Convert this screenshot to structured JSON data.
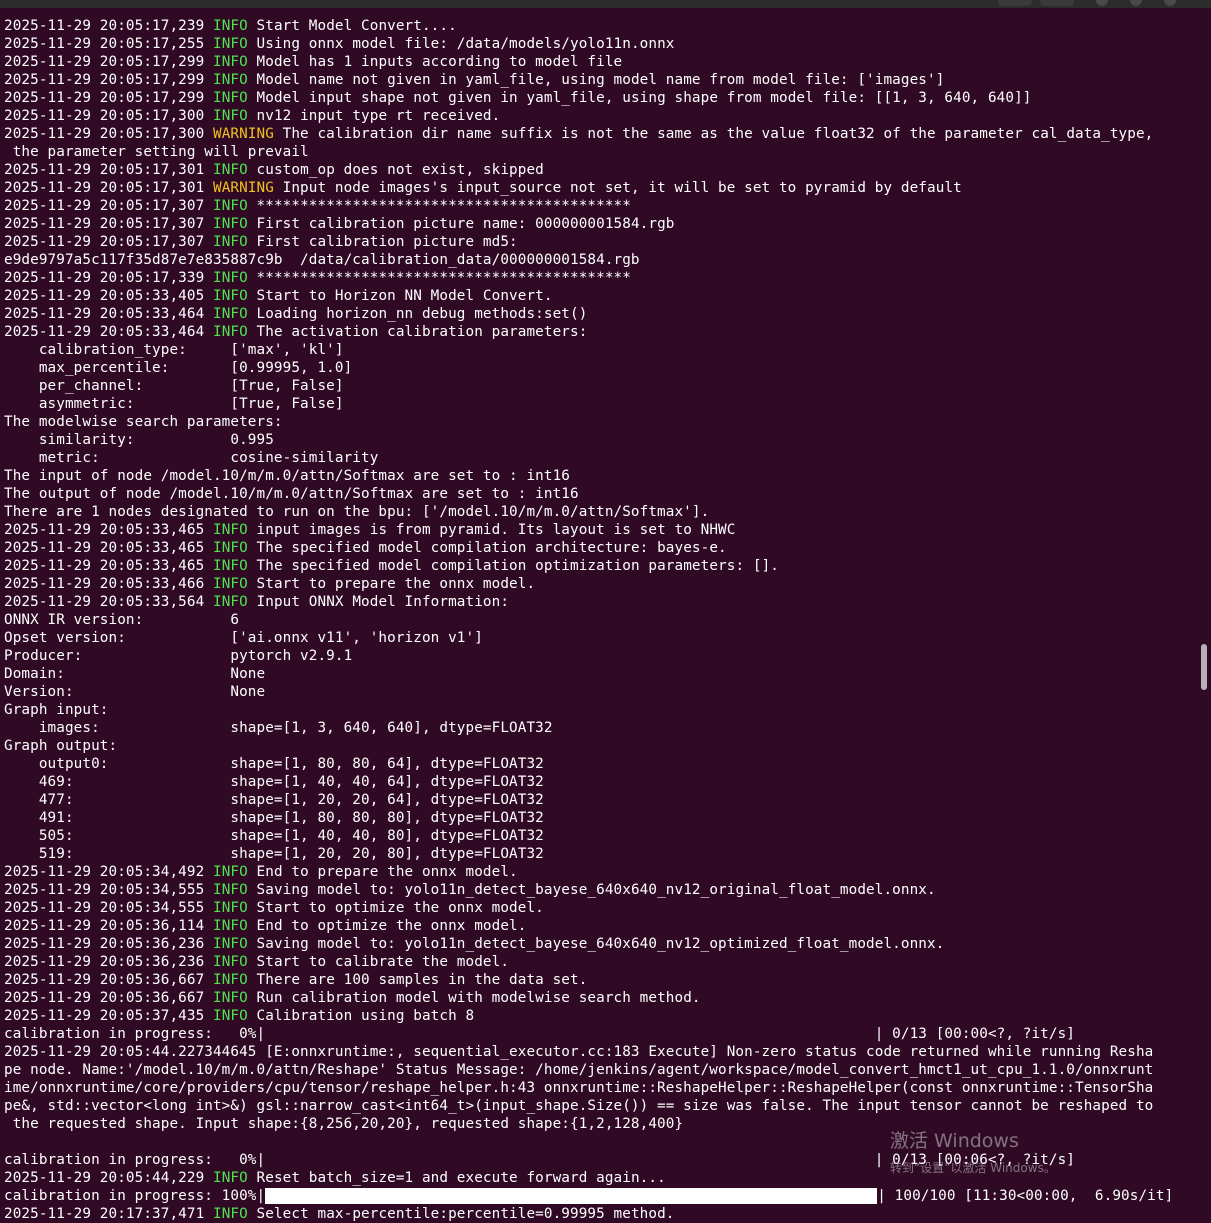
{
  "terminal": {
    "lines": [
      [
        {
          "t": "2025-11-29 20:05:17,239 "
        },
        {
          "t": "INFO",
          "c": "info"
        },
        {
          "t": " Start Model Convert...."
        }
      ],
      [
        {
          "t": "2025-11-29 20:05:17,255 "
        },
        {
          "t": "INFO",
          "c": "info"
        },
        {
          "t": " Using onnx model file: /data/models/yolo11n.onnx"
        }
      ],
      [
        {
          "t": "2025-11-29 20:05:17,299 "
        },
        {
          "t": "INFO",
          "c": "info"
        },
        {
          "t": " Model has 1 inputs according to model file"
        }
      ],
      [
        {
          "t": "2025-11-29 20:05:17,299 "
        },
        {
          "t": "INFO",
          "c": "info"
        },
        {
          "t": " Model name not given in yaml_file, using model name from model file: ['images']"
        }
      ],
      [
        {
          "t": "2025-11-29 20:05:17,299 "
        },
        {
          "t": "INFO",
          "c": "info"
        },
        {
          "t": " Model input shape not given in yaml_file, using shape from model file: [[1, 3, 640, 640]]"
        }
      ],
      [
        {
          "t": "2025-11-29 20:05:17,300 "
        },
        {
          "t": "INFO",
          "c": "info"
        },
        {
          "t": " nv12 input type rt received."
        }
      ],
      [
        {
          "t": "2025-11-29 20:05:17,300 "
        },
        {
          "t": "WARNING",
          "c": "warn"
        },
        {
          "t": " The calibration dir name suffix is not the same as the value float32 of the parameter cal_data_type,"
        }
      ],
      [
        {
          "t": " the parameter setting will prevail"
        }
      ],
      [
        {
          "t": "2025-11-29 20:05:17,301 "
        },
        {
          "t": "INFO",
          "c": "info"
        },
        {
          "t": " custom_op does not exist, skipped"
        }
      ],
      [
        {
          "t": "2025-11-29 20:05:17,301 "
        },
        {
          "t": "WARNING",
          "c": "warn"
        },
        {
          "t": " Input node images's input_source not set, it will be set to pyramid by default"
        }
      ],
      [
        {
          "t": "2025-11-29 20:05:17,307 "
        },
        {
          "t": "INFO",
          "c": "info"
        },
        {
          "t": " *******************************************"
        }
      ],
      [
        {
          "t": "2025-11-29 20:05:17,307 "
        },
        {
          "t": "INFO",
          "c": "info"
        },
        {
          "t": " First calibration picture name: 000000001584.rgb"
        }
      ],
      [
        {
          "t": "2025-11-29 20:05:17,307 "
        },
        {
          "t": "INFO",
          "c": "info"
        },
        {
          "t": " First calibration picture md5:"
        }
      ],
      [
        {
          "t": "e9de9797a5c117f35d87e7e835887c9b  /data/calibration_data/000000001584.rgb"
        }
      ],
      [
        {
          "t": "2025-11-29 20:05:17,339 "
        },
        {
          "t": "INFO",
          "c": "info"
        },
        {
          "t": " *******************************************"
        }
      ],
      [
        {
          "t": "2025-11-29 20:05:33,405 "
        },
        {
          "t": "INFO",
          "c": "info"
        },
        {
          "t": " Start to Horizon NN Model Convert."
        }
      ],
      [
        {
          "t": "2025-11-29 20:05:33,464 "
        },
        {
          "t": "INFO",
          "c": "info"
        },
        {
          "t": " Loading horizon_nn debug methods:set()"
        }
      ],
      [
        {
          "t": "2025-11-29 20:05:33,464 "
        },
        {
          "t": "INFO",
          "c": "info"
        },
        {
          "t": " The activation calibration parameters:"
        }
      ],
      [
        {
          "t": "    calibration_type:     ['max', 'kl']"
        }
      ],
      [
        {
          "t": "    max_percentile:       [0.99995, 1.0]"
        }
      ],
      [
        {
          "t": "    per_channel:          [True, False]"
        }
      ],
      [
        {
          "t": "    asymmetric:           [True, False]"
        }
      ],
      [
        {
          "t": "The modelwise search parameters:"
        }
      ],
      [
        {
          "t": "    similarity:           0.995"
        }
      ],
      [
        {
          "t": "    metric:               cosine-similarity"
        }
      ],
      [
        {
          "t": "The input of node /model.10/m/m.0/attn/Softmax are set to : int16"
        }
      ],
      [
        {
          "t": "The output of node /model.10/m/m.0/attn/Softmax are set to : int16"
        }
      ],
      [
        {
          "t": "There are 1 nodes designated to run on the bpu: ['/model.10/m/m.0/attn/Softmax']."
        }
      ],
      [
        {
          "t": "2025-11-29 20:05:33,465 "
        },
        {
          "t": "INFO",
          "c": "info"
        },
        {
          "t": " input images is from pyramid. Its layout is set to NHWC"
        }
      ],
      [
        {
          "t": "2025-11-29 20:05:33,465 "
        },
        {
          "t": "INFO",
          "c": "info"
        },
        {
          "t": " The specified model compilation architecture: bayes-e."
        }
      ],
      [
        {
          "t": "2025-11-29 20:05:33,465 "
        },
        {
          "t": "INFO",
          "c": "info"
        },
        {
          "t": " The specified model compilation optimization parameters: []."
        }
      ],
      [
        {
          "t": "2025-11-29 20:05:33,466 "
        },
        {
          "t": "INFO",
          "c": "info"
        },
        {
          "t": " Start to prepare the onnx model."
        }
      ],
      [
        {
          "t": "2025-11-29 20:05:33,564 "
        },
        {
          "t": "INFO",
          "c": "info"
        },
        {
          "t": " Input ONNX Model Information:"
        }
      ],
      [
        {
          "t": "ONNX IR version:          6"
        }
      ],
      [
        {
          "t": "Opset version:            ['ai.onnx v11', 'horizon v1']"
        }
      ],
      [
        {
          "t": "Producer:                 pytorch v2.9.1"
        }
      ],
      [
        {
          "t": "Domain:                   None"
        }
      ],
      [
        {
          "t": "Version:                  None"
        }
      ],
      [
        {
          "t": "Graph input:"
        }
      ],
      [
        {
          "t": "    images:               shape=[1, 3, 640, 640], dtype=FLOAT32"
        }
      ],
      [
        {
          "t": "Graph output:"
        }
      ],
      [
        {
          "t": "    output0:              shape=[1, 80, 80, 64], dtype=FLOAT32"
        }
      ],
      [
        {
          "t": "    469:                  shape=[1, 40, 40, 64], dtype=FLOAT32"
        }
      ],
      [
        {
          "t": "    477:                  shape=[1, 20, 20, 64], dtype=FLOAT32"
        }
      ],
      [
        {
          "t": "    491:                  shape=[1, 80, 80, 80], dtype=FLOAT32"
        }
      ],
      [
        {
          "t": "    505:                  shape=[1, 40, 40, 80], dtype=FLOAT32"
        }
      ],
      [
        {
          "t": "    519:                  shape=[1, 20, 20, 80], dtype=FLOAT32"
        }
      ],
      [
        {
          "t": "2025-11-29 20:05:34,492 "
        },
        {
          "t": "INFO",
          "c": "info"
        },
        {
          "t": " End to prepare the onnx model."
        }
      ],
      [
        {
          "t": "2025-11-29 20:05:34,555 "
        },
        {
          "t": "INFO",
          "c": "info"
        },
        {
          "t": " Saving model to: yolo11n_detect_bayese_640x640_nv12_original_float_model.onnx."
        }
      ],
      [
        {
          "t": "2025-11-29 20:05:34,555 "
        },
        {
          "t": "INFO",
          "c": "info"
        },
        {
          "t": " Start to optimize the onnx model."
        }
      ],
      [
        {
          "t": "2025-11-29 20:05:36,114 "
        },
        {
          "t": "INFO",
          "c": "info"
        },
        {
          "t": " End to optimize the onnx model."
        }
      ],
      [
        {
          "t": "2025-11-29 20:05:36,236 "
        },
        {
          "t": "INFO",
          "c": "info"
        },
        {
          "t": " Saving model to: yolo11n_detect_bayese_640x640_nv12_optimized_float_model.onnx."
        }
      ],
      [
        {
          "t": "2025-11-29 20:05:36,236 "
        },
        {
          "t": "INFO",
          "c": "info"
        },
        {
          "t": " Start to calibrate the model."
        }
      ],
      [
        {
          "t": "2025-11-29 20:05:36,667 "
        },
        {
          "t": "INFO",
          "c": "info"
        },
        {
          "t": " There are 100 samples in the data set."
        }
      ],
      [
        {
          "t": "2025-11-29 20:05:36,667 "
        },
        {
          "t": "INFO",
          "c": "info"
        },
        {
          "t": " Run calibration model with modelwise search method."
        }
      ],
      [
        {
          "t": "2025-11-29 20:05:37,435 "
        },
        {
          "t": "INFO",
          "c": "info"
        },
        {
          "t": " Calibration using batch 8"
        }
      ],
      [
        {
          "t": "calibration in progress:   0%|                                                                      | 0/13 [00:00<?, ?it/s]"
        }
      ],
      [
        {
          "t": "2025-11-29 20:05:44.227344645 [E:onnxruntime:, sequential_executor.cc:183 Execute] Non-zero status code returned while running Resha"
        }
      ],
      [
        {
          "t": "pe node. Name:'/model.10/m/m.0/attn/Reshape' Status Message: /home/jenkins/agent/workspace/model_convert_hmct1_ut_cpu_1.1.0/onnxrunt"
        }
      ],
      [
        {
          "t": "ime/onnxruntime/core/providers/cpu/tensor/reshape_helper.h:43 onnxruntime::ReshapeHelper::ReshapeHelper(const onnxruntime::TensorSha"
        }
      ],
      [
        {
          "t": "pe&, std::vector<long int>&) gsl::narrow_cast<int64_t>(input_shape.Size()) == size was false. The input tensor cannot be reshaped to"
        }
      ],
      [
        {
          "t": " the requested shape. Input shape:{8,256,20,20}, requested shape:{1,2,128,400}"
        }
      ],
      [
        {
          "t": ""
        }
      ],
      [
        {
          "t": "calibration in progress:   0%|                                                                      | 0/13 [00:06<?, ?it/s]"
        }
      ],
      [
        {
          "t": "2025-11-29 20:05:44,229 "
        },
        {
          "t": "INFO",
          "c": "info"
        },
        {
          "t": " Reset batch_size=1 and execute forward again..."
        }
      ],
      [
        {
          "t": "calibration in progress: 100%|"
        },
        {
          "bar": true
        },
        {
          "t": "| 100/100 [11:30<00:00,  6.90s/it]"
        }
      ],
      [
        {
          "t": "2025-11-29 20:17:37,471 "
        },
        {
          "t": "INFO",
          "c": "info"
        },
        {
          "t": " Select max-percentile:percentile=0.99995 method."
        }
      ]
    ]
  },
  "progress": {
    "calibration_final": 1.0
  },
  "watermark": {
    "title": "激活 Windows",
    "subtitle": "转到“设置”以激活 Windows。"
  },
  "colors": {
    "background": "#300a24",
    "info": "#4ee44e",
    "warning": "#f0c020"
  }
}
